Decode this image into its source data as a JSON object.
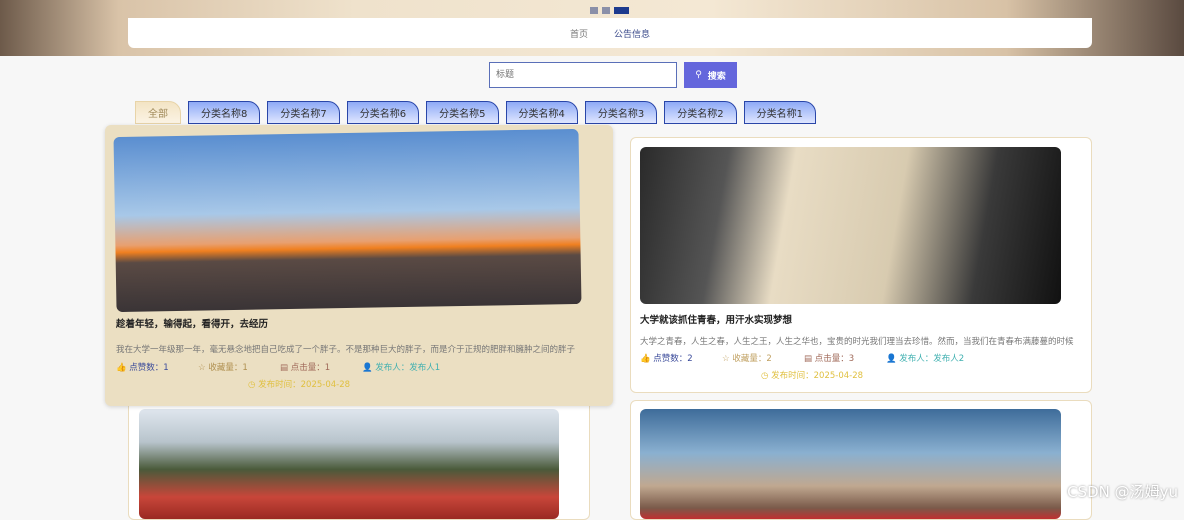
{
  "nav": {
    "items": [
      "首页",
      "公告信息"
    ]
  },
  "search": {
    "placeholder": "标题",
    "button": "搜索"
  },
  "categories": [
    "全部",
    "分类名称8",
    "分类名称7",
    "分类名称6",
    "分类名称5",
    "分类名称4",
    "分类名称3",
    "分类名称2",
    "分类名称1"
  ],
  "cards": [
    {
      "title": "趁着年轻，输得起，看得开，去经历",
      "desc": "我在大学一年级那一年，毫无悬念地把自己吃成了一个胖子。不是那种巨大的胖子，而是介于正规的肥胖和臃肿之间的胖子",
      "likes": "点赞数：1",
      "favs": "收藏量：1",
      "clicks": "点击量：1",
      "author": "发布人：发布人1",
      "time": "发布时间：2025-04-28"
    },
    {
      "title": "大学就该抓住青春，用汗水实现梦想",
      "desc": "大学之青春，人生之春，人生之王，人生之华也，宝贵的时光我们理当去珍惜。然而，当我们在青春布满藤蔓的时候",
      "likes": "点赞数：2",
      "favs": "收藏量：2",
      "clicks": "点击量：3",
      "author": "发布人：发布人2",
      "time": "发布时间：2025-04-28"
    }
  ],
  "watermark": "CSDN @汤姆yu"
}
